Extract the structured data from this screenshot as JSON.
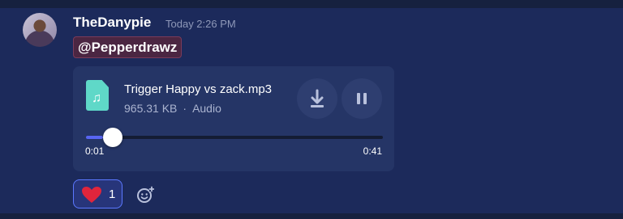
{
  "message": {
    "author": "TheDanypie",
    "timestamp": "Today 2:26 PM",
    "mention": "@Pepperdrawz"
  },
  "attachment": {
    "file_name": "Trigger Happy vs zack.mp3",
    "file_size": "965.31 KB",
    "separator": "·",
    "file_type": "Audio",
    "current_time": "0:01",
    "total_time": "0:41",
    "progress": 0.024,
    "icons": {
      "file": "audio-file-icon",
      "download": "download-icon",
      "pause": "pause-icon"
    }
  },
  "reactions": [
    {
      "emoji": "heart",
      "count": "1"
    }
  ],
  "colors": {
    "background": "#1c2a5b",
    "card": "#253566",
    "accent": "#5865f2",
    "mention_bg": "#4b2642",
    "file_icon": "#5fd8c8",
    "heart": "#e0253c"
  }
}
